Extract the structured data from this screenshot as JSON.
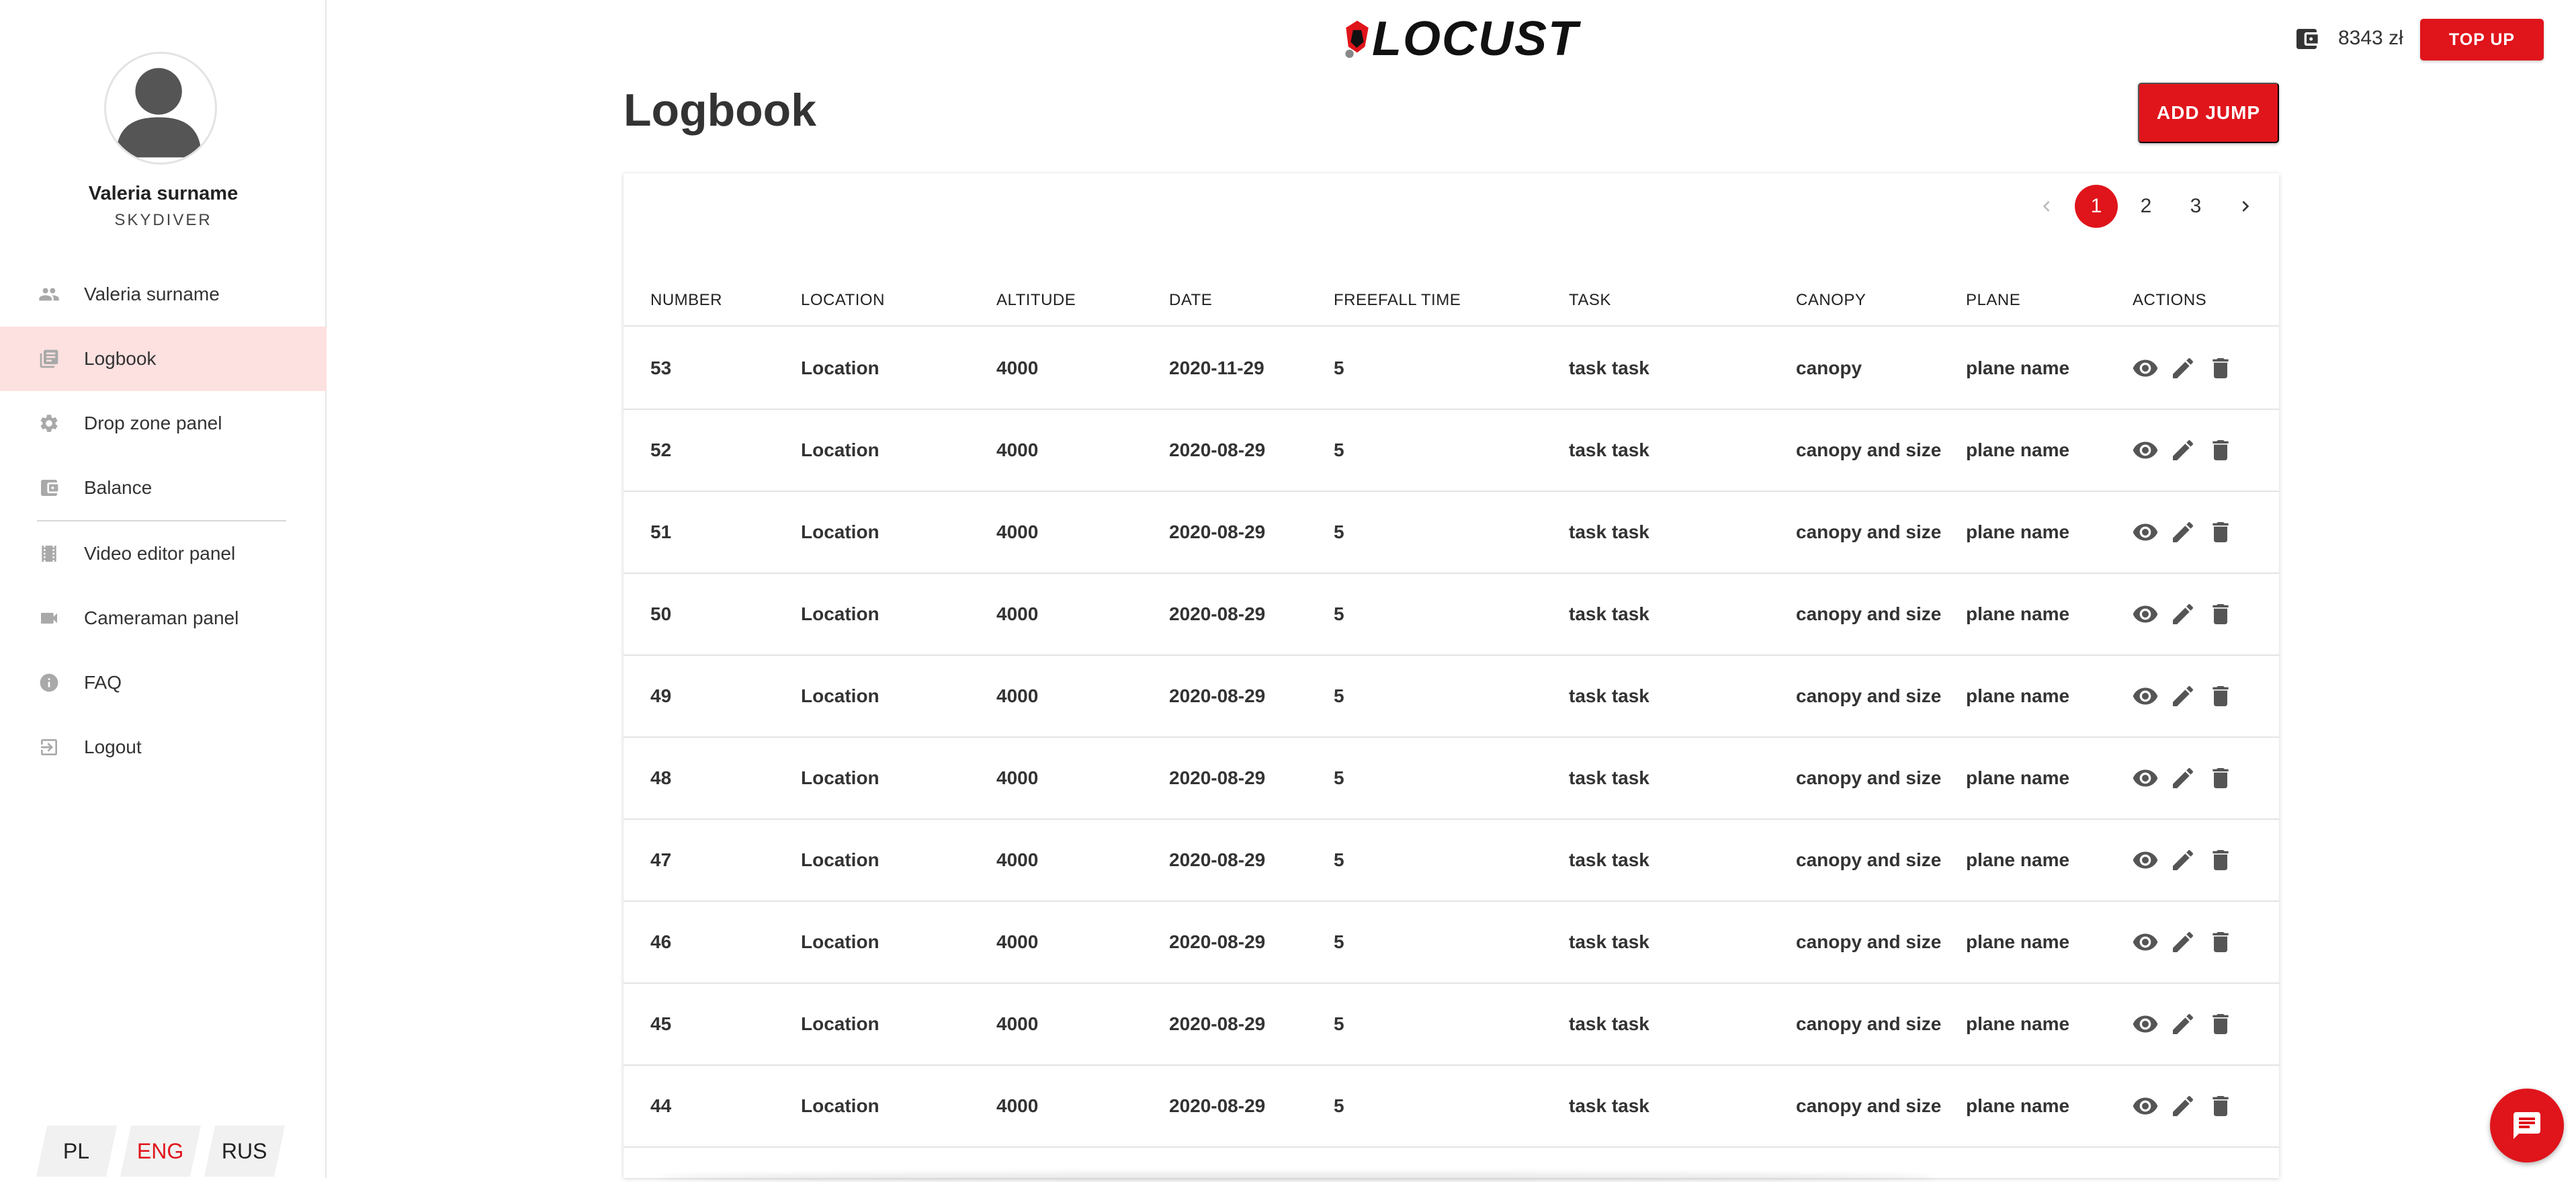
{
  "brand": {
    "logo_text": "LOCUST",
    "accent_color": "#e0141b"
  },
  "header": {
    "balance": "8343 zł",
    "topup_label": "TOP UP",
    "wallet_icon": "wallet-icon"
  },
  "user": {
    "name": "Valeria surname",
    "role": "SKYDIVER"
  },
  "sidebar": {
    "items": [
      {
        "label": "Valeria surname",
        "icon": "people-icon"
      },
      {
        "label": "Logbook",
        "icon": "logbook-icon",
        "active": true
      },
      {
        "label": "Drop zone panel",
        "icon": "gear-icon"
      },
      {
        "label": "Balance",
        "icon": "wallet-icon"
      },
      {
        "label": "Video editor panel",
        "icon": "film-icon"
      },
      {
        "label": "Cameraman panel",
        "icon": "camera-icon"
      },
      {
        "label": "FAQ",
        "icon": "info-icon"
      },
      {
        "label": "Logout",
        "icon": "logout-icon"
      }
    ],
    "languages": [
      "PL",
      "ENG",
      "RUS"
    ],
    "active_language": "ENG"
  },
  "main": {
    "title": "Logbook",
    "add_label": "ADD JUMP",
    "pagination": {
      "pages": [
        "1",
        "2",
        "3"
      ],
      "current": "1"
    },
    "columns": [
      "NUMBER",
      "LOCATION",
      "ALTITUDE",
      "DATE",
      "FREEFALL TIME",
      "TASK",
      "CANOPY",
      "PLANE",
      "ACTIONS"
    ],
    "rows": [
      [
        "53",
        "Location",
        "4000",
        "2020-11-29",
        "5",
        "task task",
        "canopy",
        "plane name"
      ],
      [
        "52",
        "Location",
        "4000",
        "2020-08-29",
        "5",
        "task task",
        "canopy and size",
        "plane name"
      ],
      [
        "51",
        "Location",
        "4000",
        "2020-08-29",
        "5",
        "task task",
        "canopy and size",
        "plane name"
      ],
      [
        "50",
        "Location",
        "4000",
        "2020-08-29",
        "5",
        "task task",
        "canopy and size",
        "plane name"
      ],
      [
        "49",
        "Location",
        "4000",
        "2020-08-29",
        "5",
        "task task",
        "canopy and size",
        "plane name"
      ],
      [
        "48",
        "Location",
        "4000",
        "2020-08-29",
        "5",
        "task task",
        "canopy and size",
        "plane name"
      ],
      [
        "47",
        "Location",
        "4000",
        "2020-08-29",
        "5",
        "task task",
        "canopy and size",
        "plane name"
      ],
      [
        "46",
        "Location",
        "4000",
        "2020-08-29",
        "5",
        "task task",
        "canopy and size",
        "plane name"
      ],
      [
        "45",
        "Location",
        "4000",
        "2020-08-29",
        "5",
        "task task",
        "canopy and size",
        "plane name"
      ],
      [
        "44",
        "Location",
        "4000",
        "2020-08-29",
        "5",
        "task task",
        "canopy and size",
        "plane name"
      ]
    ]
  }
}
